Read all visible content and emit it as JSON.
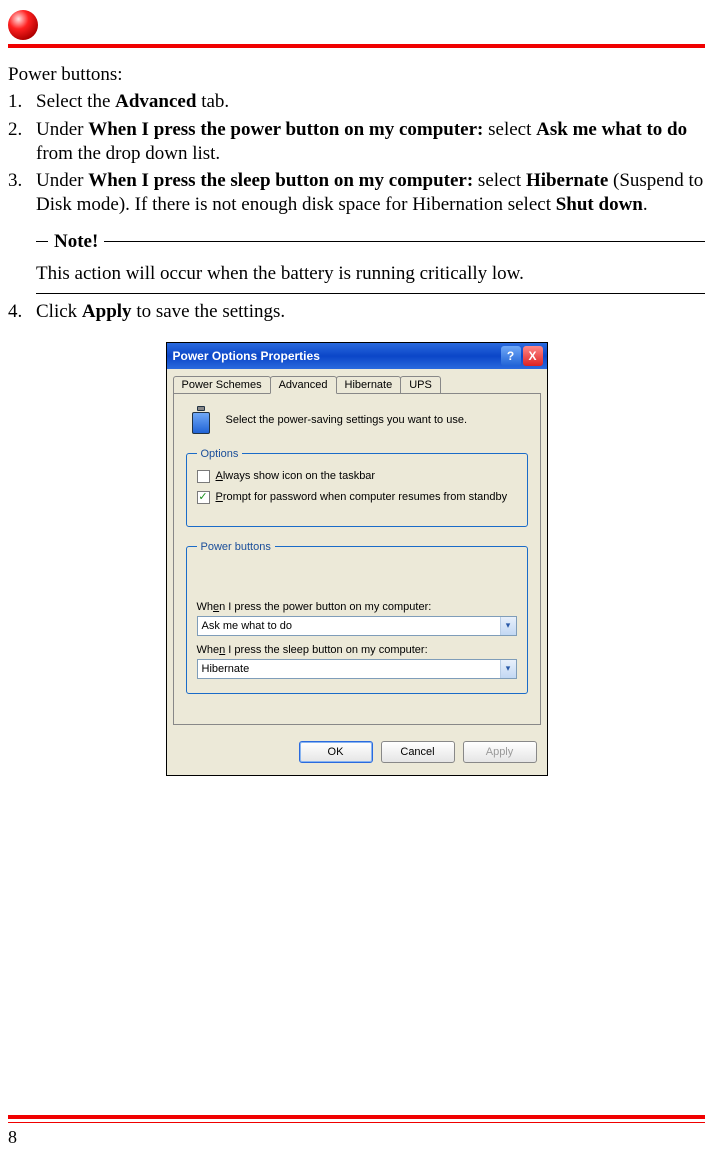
{
  "intro": "Power buttons:",
  "steps": {
    "s1": {
      "num": "1.",
      "pre": "Select the ",
      "bold": "Advanced",
      "post": " tab."
    },
    "s2": {
      "num": "2.",
      "pre": "Under ",
      "bold1": "When I press the power button on my computer:",
      "mid": " select ",
      "bold2": "Ask me what to do",
      "post": " from the drop down list."
    },
    "s3": {
      "num": "3.",
      "pre": "Under ",
      "bold1": "When I press the sleep button on my computer:",
      "mid1": " select ",
      "bold2": "Hibernate",
      "mid2": " (Suspend to Disk mode). If there is not enough disk space for Hibernation select ",
      "bold3": "Shut down",
      "post": "."
    },
    "s4": {
      "num": "4.",
      "pre": "Click ",
      "bold": "Apply",
      "post": " to save the settings."
    }
  },
  "note": {
    "label": "Note!",
    "body": "This action will occur when the battery is running critically low."
  },
  "dialog": {
    "title": "Power Options Properties",
    "help": "?",
    "close": "X",
    "tabs": {
      "t1": "Power Schemes",
      "t2": "Advanced",
      "t3": "Hibernate",
      "t4": "UPS"
    },
    "desc": "Select the power-saving settings you want to use.",
    "options_legend": "Options",
    "chk1": "Always show icon on the taskbar",
    "chk2": "Prompt for password when computer resumes from standby",
    "pb_legend": "Power buttons",
    "pb_label1": "When I press the power button on my computer:",
    "pb_value1": "Ask me what to do",
    "pb_label2": "When I press the sleep button on my computer:",
    "pb_value2": "Hibernate",
    "ok": "OK",
    "cancel": "Cancel",
    "apply": "Apply"
  },
  "page_number": "8"
}
